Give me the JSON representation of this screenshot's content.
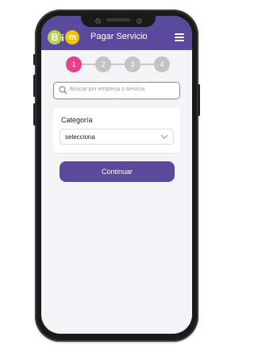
{
  "header": {
    "title": "Pagar Servicio",
    "logo": {
      "b": "B",
      "i": "i",
      "m": "m"
    },
    "menu_icon": "hamburger-menu-icon"
  },
  "stepper": {
    "steps": [
      "1",
      "2",
      "3",
      "4"
    ],
    "active_step": 1
  },
  "search": {
    "placeholder": "Buscar por empresa o servicio",
    "icon": "search-icon"
  },
  "category": {
    "label": "Categoría",
    "value": "selecciona",
    "icon": "chevron-down-icon"
  },
  "continue_button": {
    "label": "Continuar"
  },
  "colors": {
    "brand": "#5a4a9e",
    "active_step": "#e8418a",
    "inactive_step": "#c4c4c4",
    "logo_green": "#b7d44a",
    "logo_yellow": "#f3c200"
  }
}
